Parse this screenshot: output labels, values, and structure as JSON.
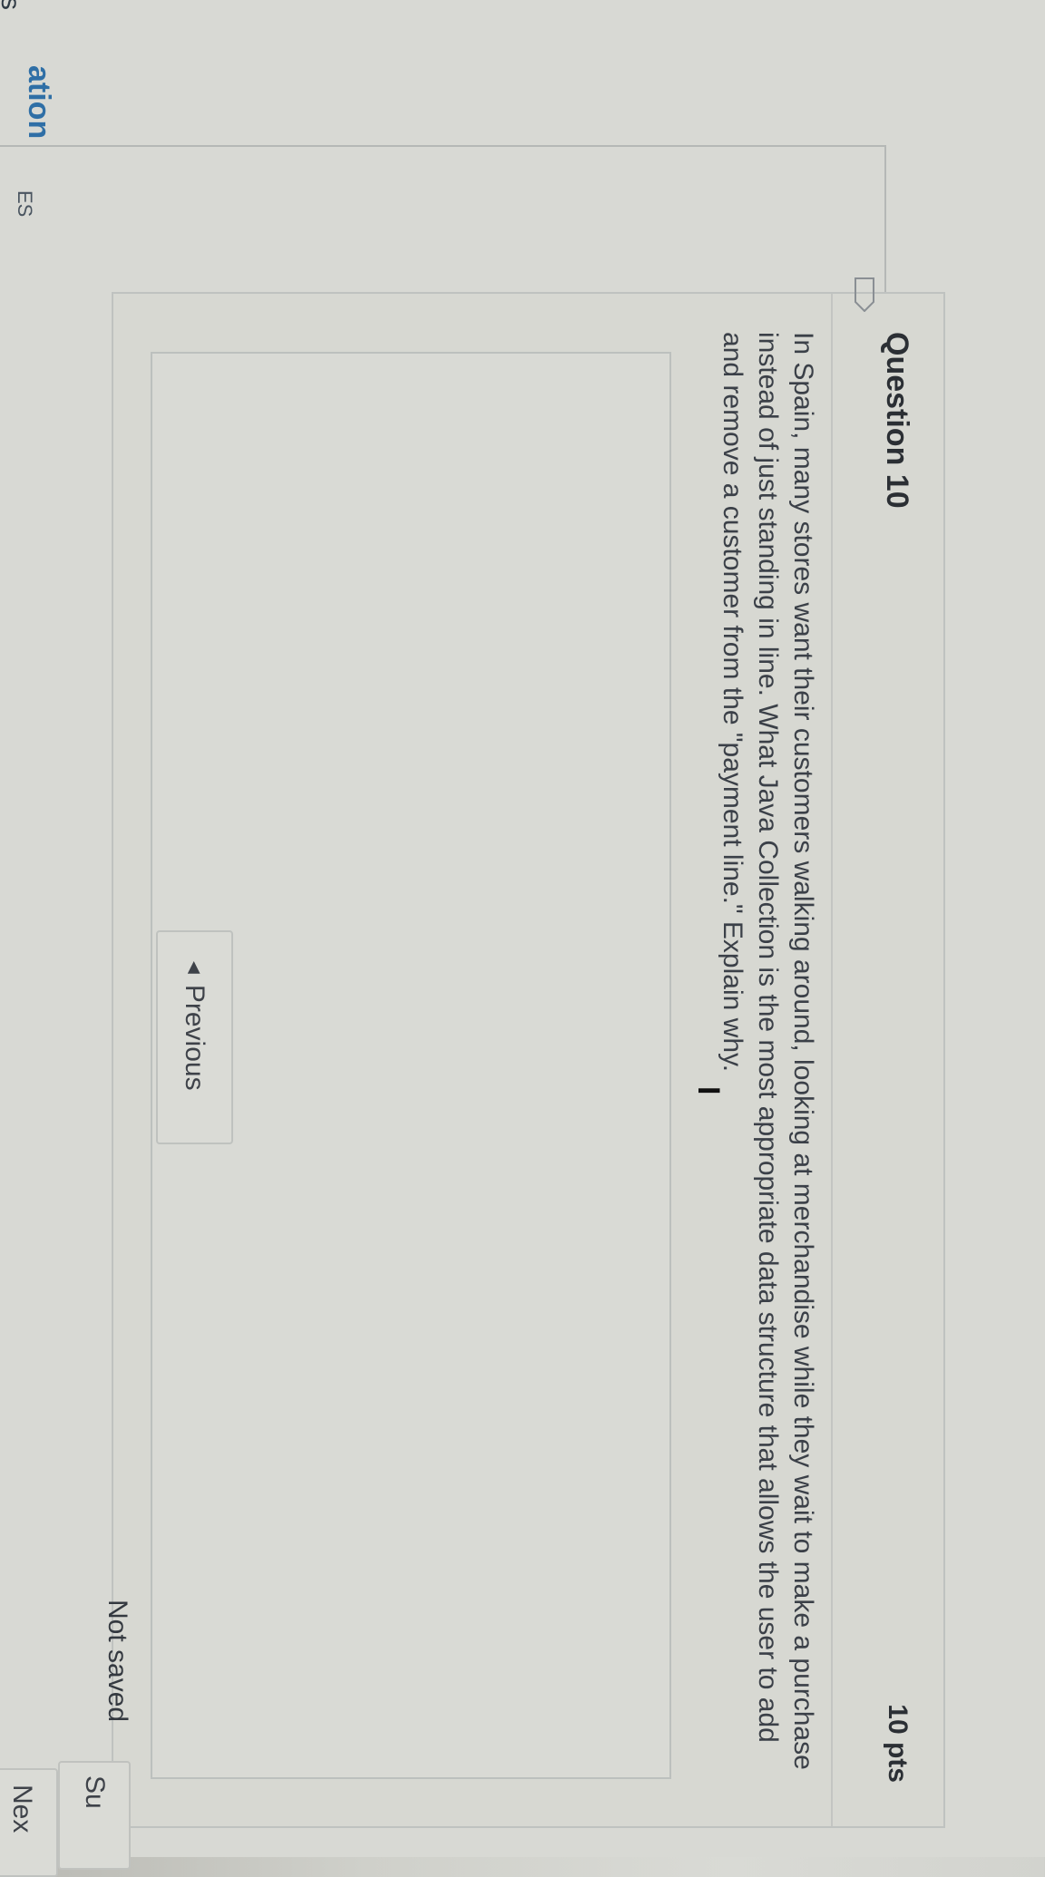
{
  "edge": {
    "top_fragment": "s",
    "header_fragment": "ES",
    "nav_fragment": "ation"
  },
  "question": {
    "title": "Question 10",
    "points": "10 pts",
    "text": "In Spain, many stores want their customers walking around, looking at merchandise while they wait to make a purchase instead of just standing in line. What Java Collection is the most appropriate data structure that allows the user to add and remove a customer from the \"payment line.\" Explain why.",
    "answer_value": ""
  },
  "navigation": {
    "previous_label": "Previous",
    "previous_icon": "left-triangle-icon",
    "next_label": "Nex"
  },
  "footer": {
    "status": "Not saved",
    "submit_label": "Su"
  },
  "icons": {
    "question_flag": "flag-icon",
    "cursor": "i-beam-cursor-icon"
  },
  "colors": {
    "accent": "#2f6fa6",
    "text": "#3b4048",
    "border": "#bfc2c0"
  }
}
